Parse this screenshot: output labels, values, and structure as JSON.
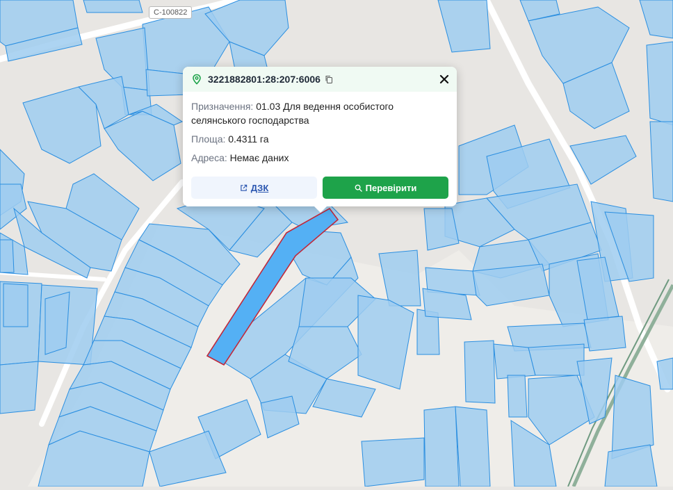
{
  "map": {
    "road_label": "С-100822",
    "colors": {
      "background": "#e8e6e3",
      "parcel_fill": "#9fcdf0",
      "parcel_stroke": "#2a8ee0",
      "selected_fill": "#54b0f4",
      "selected_stroke": "#c0283a",
      "road": "#ffffff",
      "railway": "#8fb09a"
    }
  },
  "popup": {
    "cadastral_number": "3221882801:28:207:6006",
    "purpose_label": "Призначення:",
    "purpose_value": "01.03 Для ведення особистого селянського господарства",
    "area_label": "Площа:",
    "area_value": "0.4311 га",
    "address_label": "Адреса:",
    "address_value": "Немає даних",
    "dzk_button": "ДЗК",
    "check_button": "Перевірити",
    "icons": [
      "location-pin-icon",
      "copy-icon",
      "close-icon",
      "external-link-icon",
      "search-icon"
    ],
    "colors": {
      "header_bg": "#f0faf3",
      "primary_green": "#1ea34a",
      "link_blue": "#2b56b0"
    }
  }
}
